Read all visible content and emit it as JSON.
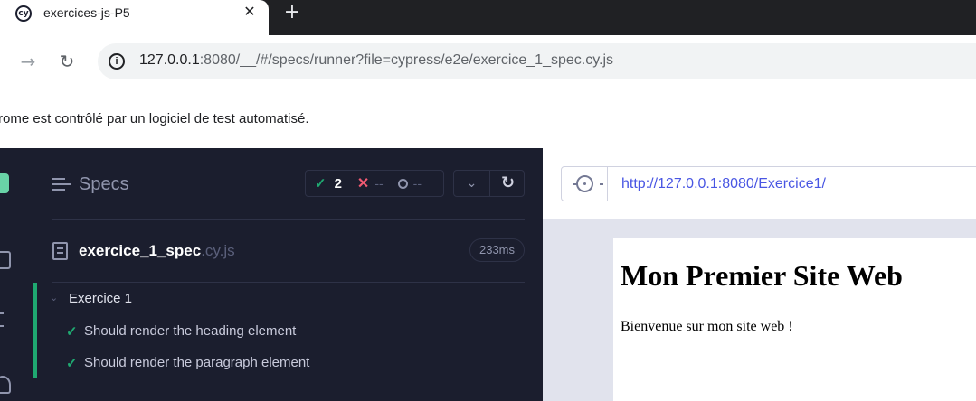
{
  "browser": {
    "tab_title": "exercices-js-P5",
    "tab_favicon": "cy",
    "tab_close": "✕",
    "new_tab": "+",
    "nav_forward": "→",
    "nav_reload": "↻",
    "url_host": "127.0.0.1",
    "url_rest": ":8080/__/#/specs/runner?file=cypress/e2e/exercice_1_spec.cy.js",
    "info_icon": "i",
    "infobar_text": "rome est contrôlé par un logiciel de test automatisé."
  },
  "reporter": {
    "header_title": "Specs",
    "stats": {
      "pass_icon": "✓",
      "passed": "2",
      "fail_icon": "✕",
      "failed": "--",
      "pending": "--"
    },
    "collapse_icon": "⌄",
    "rerun_icon": "↻",
    "spec": {
      "name": "exercice_1_spec",
      "ext": ".cy.js",
      "duration": "233ms"
    },
    "suite": {
      "chevron": "⌄",
      "title": "Exercice 1",
      "tests": [
        {
          "icon": "✓",
          "title": "Should render the heading element",
          "state": "passed"
        },
        {
          "icon": "✓",
          "title": "Should render the paragraph element",
          "state": "passed"
        }
      ]
    }
  },
  "aut": {
    "url": "http://127.0.0.1:8080/Exercice1/",
    "heading": "Mon Premier Site Web",
    "paragraph": "Bienvenue sur mon site web !"
  },
  "colors": {
    "cypress_dark": "#1b1e2e",
    "pass_green": "#1fa971",
    "fail_red": "#f15a72",
    "link_indigo": "#4956e3"
  }
}
